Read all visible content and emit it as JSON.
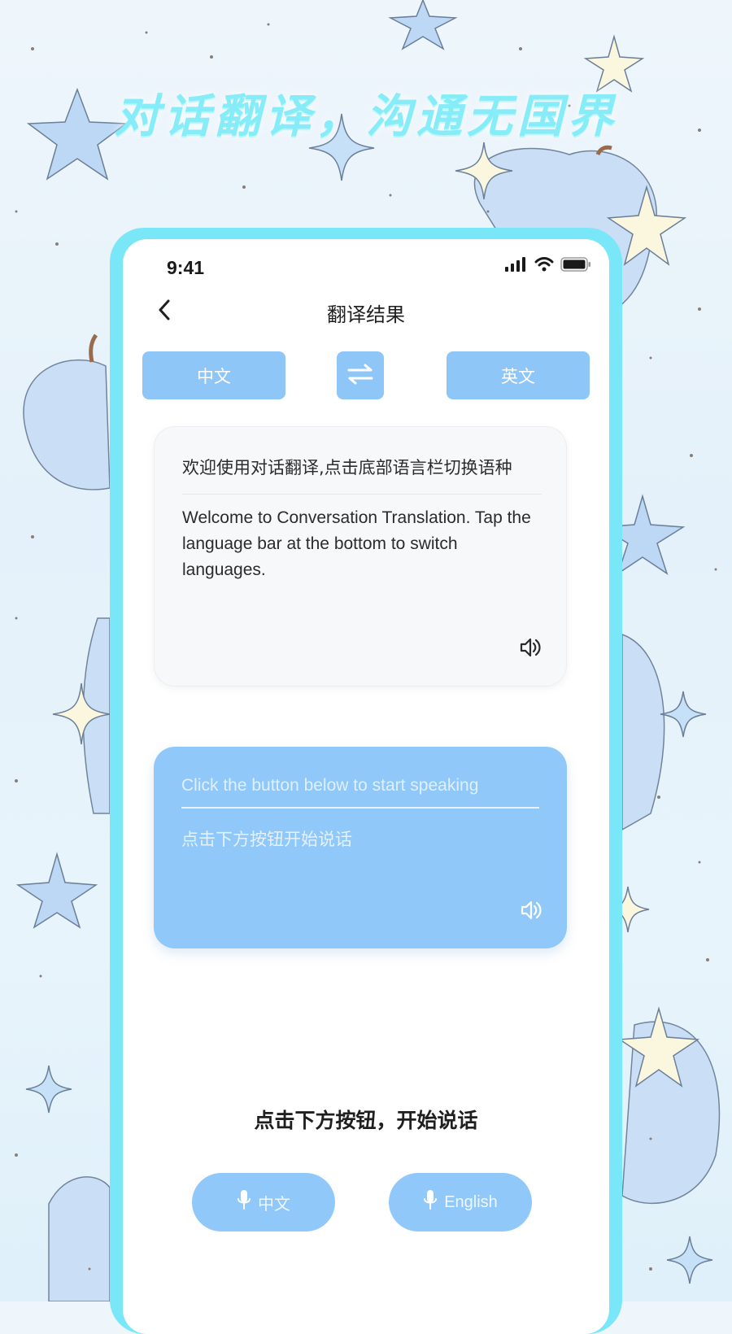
{
  "headline": "对话翻译，沟通无国界",
  "status_bar": {
    "time": "9:41",
    "icons": [
      "signal-icon",
      "wifi-icon",
      "battery-icon"
    ]
  },
  "nav": {
    "back_icon": "chevron-left-icon",
    "title": "翻译结果"
  },
  "language_bar": {
    "source": "中文",
    "target": "英文",
    "swap_icon": "swap-arrows-icon"
  },
  "result_card": {
    "source_text": "欢迎使用对话翻译,点击底部语言栏切换语种",
    "translated_text": "Welcome to Conversation Translation. Tap the language bar at the bottom to switch languages.",
    "speaker_icon": "speaker-icon"
  },
  "input_card": {
    "hint_en": "Click the button below to start speaking",
    "hint_zh": "点击下方按钮开始说话",
    "speaker_icon": "speaker-icon"
  },
  "bottom_prompt": "点击下方按钮，开始说话",
  "mic_buttons": [
    {
      "label": "中文",
      "icon": "microphone-icon"
    },
    {
      "label": "English",
      "icon": "microphone-icon"
    }
  ],
  "colors": {
    "accent": "#8ec6f8",
    "frame": "#79e7f7",
    "headline": "#86ecf8"
  }
}
